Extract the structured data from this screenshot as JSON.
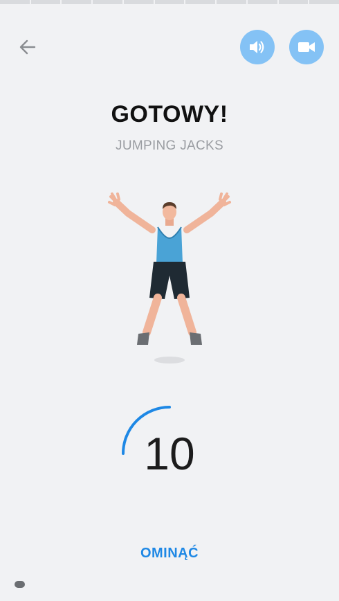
{
  "header": {
    "back_icon": "arrow-left-icon",
    "sound_icon": "volume-icon",
    "video_icon": "video-camera-icon"
  },
  "progress": {
    "segments": 11,
    "completed": 0
  },
  "exercise": {
    "title": "GOTOWY!",
    "name": "JUMPING JACKS"
  },
  "countdown": {
    "value": "10",
    "fraction_remaining": 0.25
  },
  "actions": {
    "skip_label": "OMINĄĆ"
  },
  "colors": {
    "accent": "#1e88e5",
    "button_bg": "#84c2f5",
    "background": "#f1f2f4"
  }
}
